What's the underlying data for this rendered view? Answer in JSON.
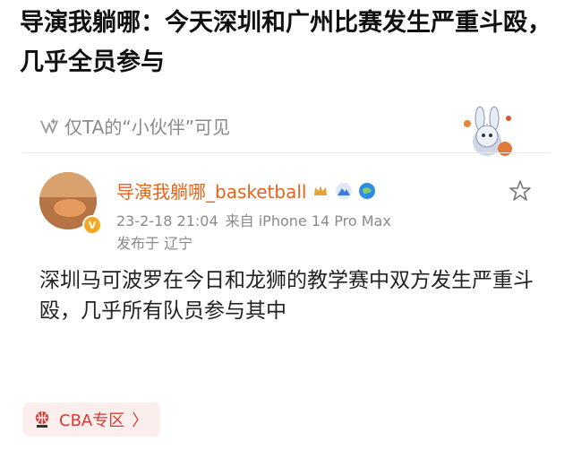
{
  "headline": "导演我躺哪：今天深圳和广州比赛发生严重斗殴，几乎全员参与",
  "post": {
    "visibility_text": "仅TA的“小伙伴”可见",
    "username": "导演我躺哪_basketball",
    "timestamp": "23-2-18 21:04",
    "source": "来自 iPhone 14 Pro Max",
    "location": "发布于 辽宁",
    "body": "深圳马可波罗在今日和龙狮的教学赛中双方发生严重斗殴，几乎所有队员参与其中",
    "topic_chip": "CBA专区",
    "topic_chevron": "〉",
    "vip_badge": "V"
  },
  "icons": {
    "visibility": "eye-visibility-icon",
    "star": "star-icon",
    "crown_badge": "crown-badge-icon",
    "mountain_badge": "mountain-badge-icon",
    "globe_badge": "globe-badge-icon",
    "cba_logo": "cba-logo-icon",
    "sticker": "mascot-sticker"
  },
  "colors": {
    "username": "#e8631a",
    "meta": "#8a8a8a",
    "chip_bg": "#fdeeee",
    "chip_text": "#d9382d"
  }
}
